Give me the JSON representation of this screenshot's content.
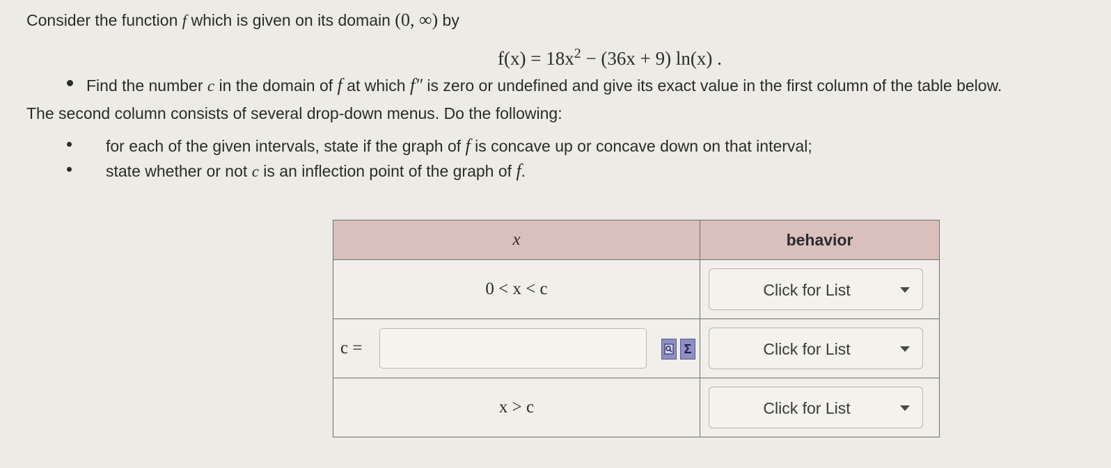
{
  "intro": {
    "text_before": "Consider the function ",
    "f_symbol": "f",
    "text_after": " which is given on its domain ",
    "domain": "(0, ∞)",
    "text_end": " by"
  },
  "formula": {
    "lhs": "f(x) = 18x",
    "exp": "2",
    "rhs": " − (36x + 9) ln(x) ."
  },
  "instruction1": {
    "part1": "Find the number ",
    "c": "c",
    "part2": " in the domain of ",
    "f": "f",
    "part3": " at which ",
    "fpp": "f″",
    "part4": " is zero or undefined and give its exact value in the first column of the table below."
  },
  "instruction2": "The second column consists of several drop-down menus.  Do the following:",
  "list": {
    "item1_part1": "for each of the given intervals, state if the graph of ",
    "item1_f": "f",
    "item1_part2": " is concave up or concave down on that interval;",
    "item2_part1": "state whether or not ",
    "item2_c": "c",
    "item2_part2": " is an inflection point of the graph of ",
    "item2_f": "f",
    "item2_part3": "."
  },
  "table": {
    "col_x_header": "x",
    "col_behavior_header": "behavior",
    "row1_condition": "0 < x < c",
    "row2_label": "c =",
    "row2_value": "",
    "row3_condition": "x > c",
    "dropdown1": "Click for List",
    "dropdown2": "Click for List",
    "dropdown3": "Click for List"
  }
}
